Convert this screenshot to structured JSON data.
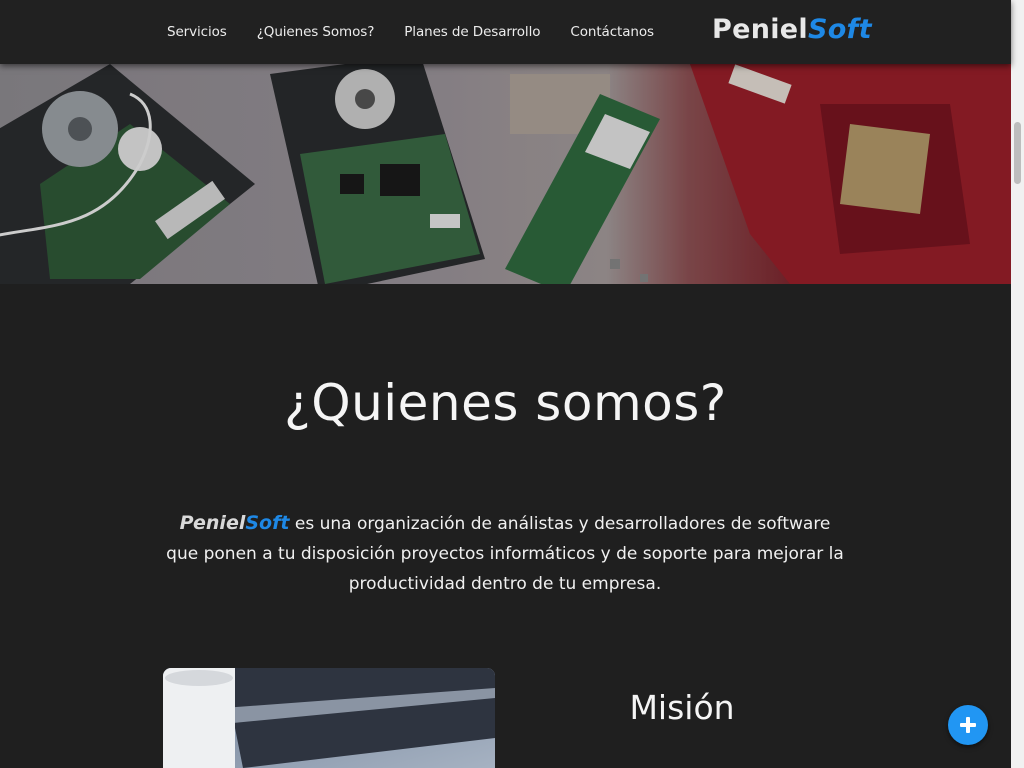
{
  "nav": {
    "links": [
      "Servicios",
      "¿Quienes Somos?",
      "Planes de Desarrollo",
      "Contáctanos"
    ],
    "brand": {
      "part1": "Peniel",
      "part2": "Soft"
    }
  },
  "about": {
    "title": "¿Quienes somos?",
    "brand": {
      "part1": "Peniel",
      "part2": "Soft"
    },
    "text": " es una organización de análistas y desarrolladores de software que ponen a tu disposición proyectos informáticos y de soporte para mejorar la productividad dentro de tu empresa."
  },
  "mision": {
    "title": "Misión"
  },
  "colors": {
    "accent": "#1e88e5",
    "background": "#1f1f1f",
    "navbar": "#212121",
    "fab": "#2196f3"
  },
  "icons": {
    "fab": "plus-icon"
  }
}
